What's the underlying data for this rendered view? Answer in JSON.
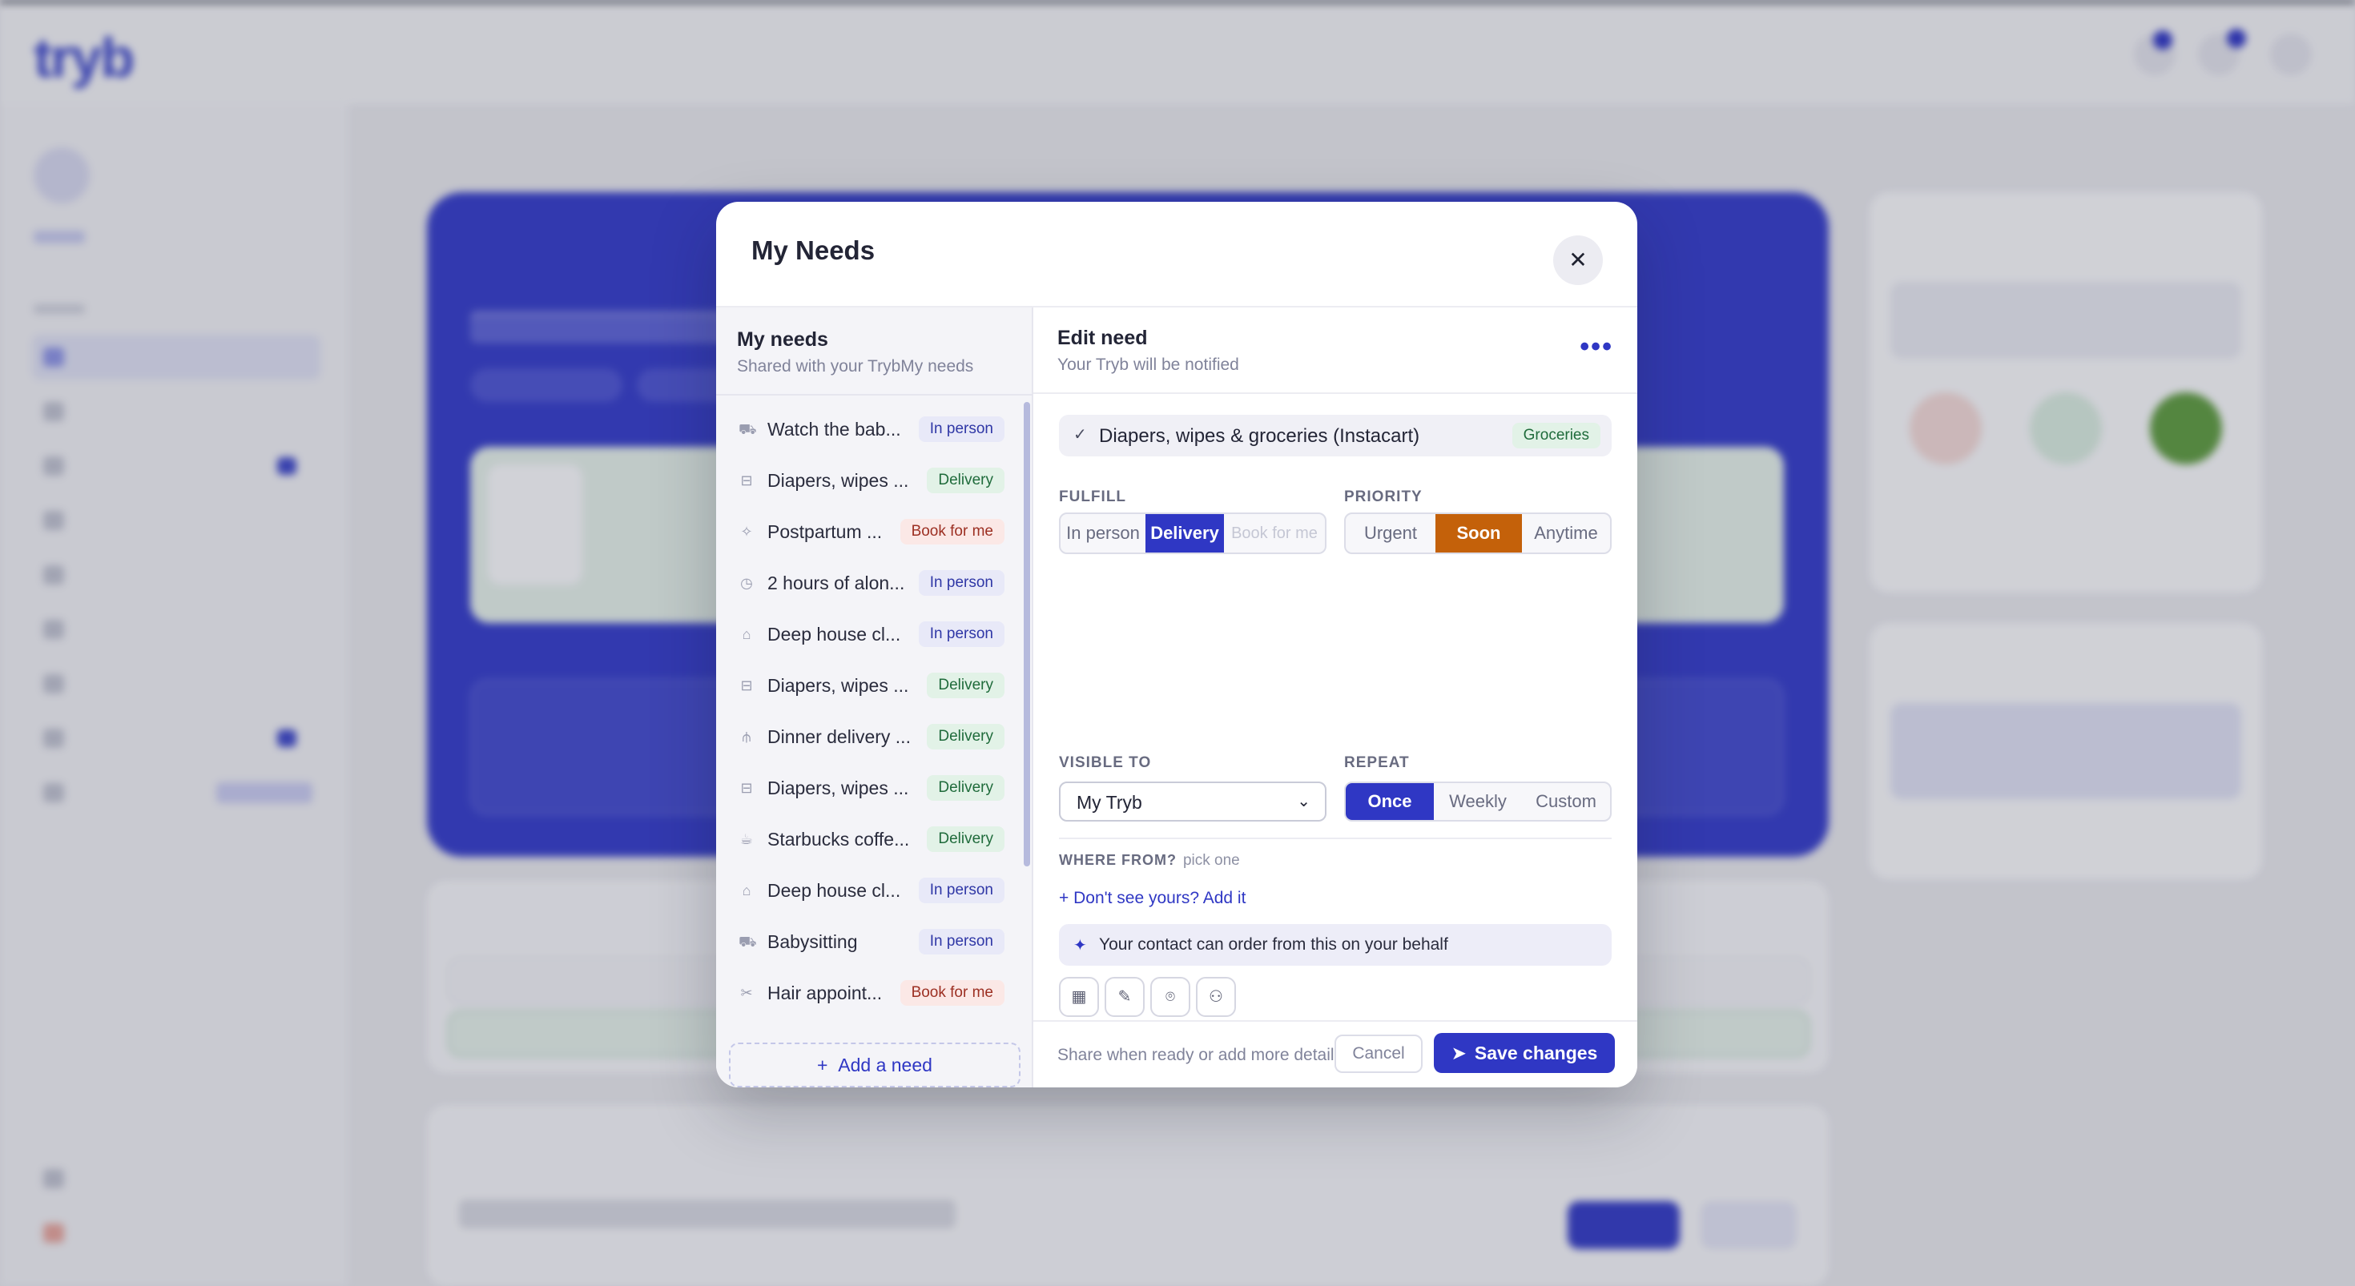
{
  "colors": {
    "brand": "#2f37c4",
    "priority_active": "#c4610a",
    "delivery_tag_bg": "#e2f2e7",
    "inperson_tag_bg": "#e8e9f8",
    "book_tag_bg": "#fbe8e6"
  },
  "background": {
    "logo": "tryb"
  },
  "modal": {
    "title": "My Needs",
    "close_icon": "close-icon"
  },
  "left": {
    "title": "My needs",
    "subtitle": "Shared with your TrybMy needs",
    "needs": [
      {
        "name": "Watch the bab...",
        "tag": "In person",
        "icon": "stroller-icon"
      },
      {
        "name": "Diapers, wipes ...",
        "tag": "Delivery",
        "icon": "cart-icon"
      },
      {
        "name": "Postpartum ...",
        "tag": "Book for me",
        "icon": "sparkle-icon"
      },
      {
        "name": "2 hours of alon...",
        "tag": "In person",
        "icon": "clock-icon"
      },
      {
        "name": "Deep house cl...",
        "tag": "In person",
        "icon": "home-icon"
      },
      {
        "name": "Diapers, wipes ...",
        "tag": "Delivery",
        "icon": "cart-icon"
      },
      {
        "name": "Dinner delivery ...",
        "tag": "Delivery",
        "icon": "utensils-icon"
      },
      {
        "name": "Diapers, wipes ...",
        "tag": "Delivery",
        "icon": "cart-icon"
      },
      {
        "name": "Starbucks coffe...",
        "tag": "Delivery",
        "icon": "coffee-icon"
      },
      {
        "name": "Deep house cl...",
        "tag": "In person",
        "icon": "home-icon"
      },
      {
        "name": "Babysitting",
        "tag": "In person",
        "icon": "stroller-icon"
      },
      {
        "name": "Hair appoint...",
        "tag": "Book for me",
        "icon": "scissors-icon"
      }
    ],
    "add_need": "Add a need"
  },
  "edit": {
    "title": "Edit need",
    "subtitle": "Your Tryb will be notified",
    "selected": {
      "name": "Diapers, wipes & groceries (Instacart)",
      "tag": "Groceries"
    },
    "fulfill": {
      "label": "FULFILL",
      "options": [
        "In person",
        "Delivery",
        "Book for me"
      ],
      "selected": "Delivery"
    },
    "priority": {
      "label": "PRIORITY",
      "options": [
        "Urgent",
        "Soon",
        "Anytime"
      ],
      "selected": "Soon"
    },
    "visible_to": {
      "label": "VISIBLE TO",
      "value": "My Tryb"
    },
    "repeat": {
      "label": "REPEAT",
      "options": [
        "Once",
        "Weekly",
        "Custom"
      ],
      "selected": "Once"
    },
    "where_from": {
      "label": "WHERE FROM?",
      "hint": "pick one",
      "add_link": "Don't see yours? Add it"
    },
    "info": "Your contact can order from this on your behalf",
    "tools": [
      "calendar-icon",
      "pencil-icon",
      "location-pin-icon",
      "people-icon"
    ]
  },
  "footer": {
    "hint": "Share when ready or add more detail",
    "cancel": "Cancel",
    "save": "Save changes"
  }
}
